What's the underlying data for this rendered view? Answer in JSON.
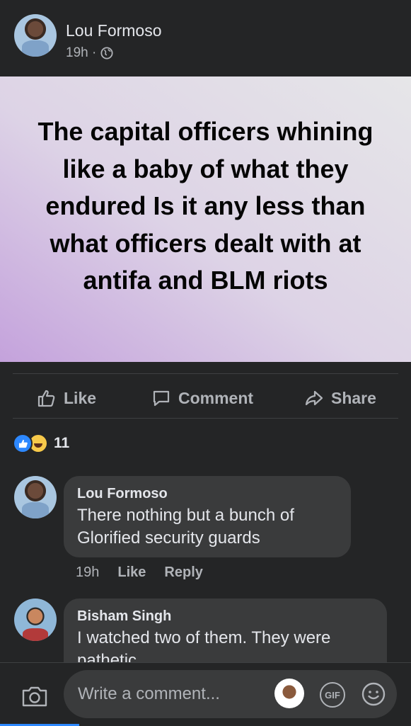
{
  "post": {
    "author": "Lou Formoso",
    "time": "19h ·",
    "privacy_icon": "globe-icon",
    "text": "The capital officers whining like a baby of what they endured Is it any less than what officers dealt with at antifa and BLM riots"
  },
  "actions": {
    "like": "Like",
    "comment": "Comment",
    "share": "Share"
  },
  "reactions": {
    "types": [
      "like",
      "haha"
    ],
    "count": "11"
  },
  "comments": [
    {
      "author": "Lou Formoso",
      "text": "There  nothing but a bunch of Glorified security guards",
      "time": "19h",
      "like_label": "Like",
      "reply_label": "Reply"
    },
    {
      "author": "Bisham Singh",
      "text": "I watched two of them. They were pathetic"
    }
  ],
  "composer": {
    "placeholder": "Write a comment...",
    "gif_label": "GIF"
  },
  "colors": {
    "background": "#242526",
    "bubble": "#3a3b3c",
    "accent": "#2d88ff"
  }
}
